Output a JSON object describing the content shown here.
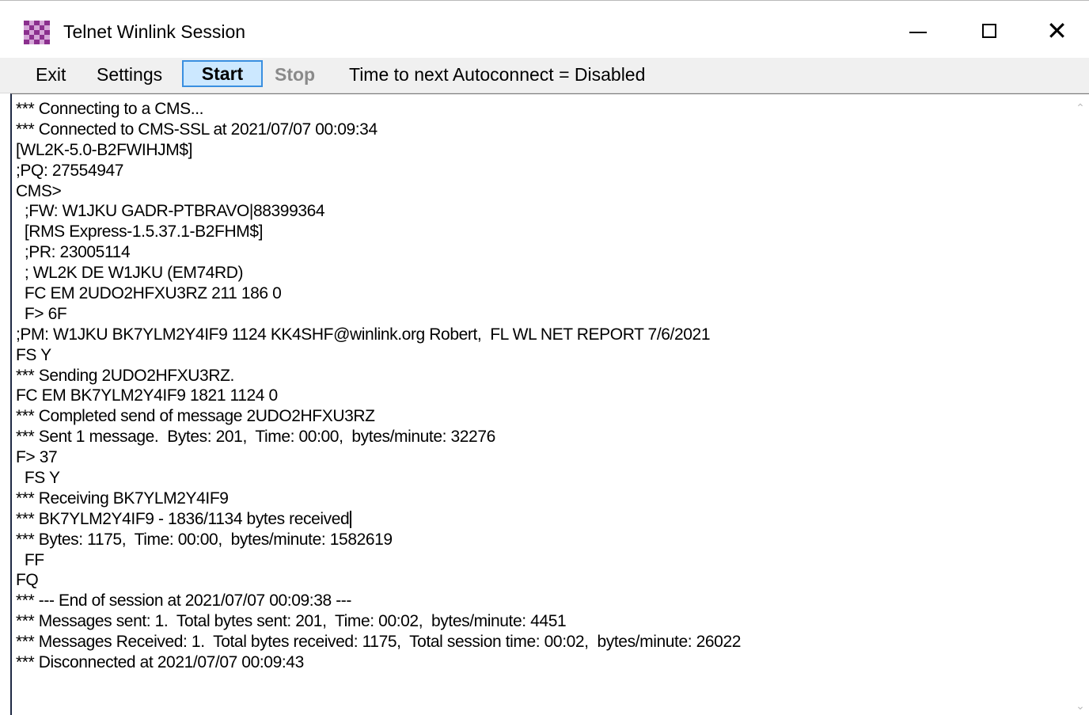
{
  "window": {
    "title": "Telnet Winlink Session",
    "icon": "winlink-checker-icon",
    "controls": {
      "minimize": "minimize-icon",
      "maximize": "maximize-icon",
      "close": "close-icon",
      "close_glyph": "✕"
    }
  },
  "menu": {
    "exit": "Exit",
    "settings": "Settings",
    "start": "Start",
    "stop": "Stop",
    "autoconnect": "Time to next Autoconnect = Disabled"
  },
  "log": {
    "lines": [
      "*** Connecting to a CMS...",
      "*** Connected to CMS-SSL at 2021/07/07 00:09:34",
      "[WL2K-5.0-B2FWIHJM$]",
      ";PQ: 27554947",
      "CMS>",
      "  ;FW: W1JKU GADR-PTBRAVO|88399364",
      "  [RMS Express-1.5.37.1-B2FHM$]",
      "  ;PR: 23005114",
      "  ; WL2K DE W1JKU (EM74RD)",
      "  FC EM 2UDO2HFXU3RZ 211 186 0",
      "  F> 6F",
      ";PM: W1JKU BK7YLM2Y4IF9 1124 KK4SHF@winlink.org Robert,  FL WL NET REPORT 7/6/2021",
      "FS Y",
      "*** Sending 2UDO2HFXU3RZ.",
      "FC EM BK7YLM2Y4IF9 1821 1124 0",
      "*** Completed send of message 2UDO2HFXU3RZ",
      "*** Sent 1 message.  Bytes: 201,  Time: 00:00,  bytes/minute: 32276",
      "F> 37",
      "  FS Y",
      "*** Receiving BK7YLM2Y4IF9",
      "*** BK7YLM2Y4IF9 - 1836/1134 bytes received",
      "*** Bytes: 1175,  Time: 00:00,  bytes/minute: 1582619",
      "  FF",
      "FQ",
      "*** --- End of session at 2021/07/07 00:09:38 ---",
      "*** Messages sent: 1.  Total bytes sent: 201,  Time: 00:02,  bytes/minute: 4451",
      "*** Messages Received: 1.  Total bytes received: 1175,  Total session time: 00:02,  bytes/minute: 26022",
      "*** Disconnected at 2021/07/07 00:09:43"
    ],
    "caret_line_index": 20
  },
  "scrollbar": {
    "up_icon": "scroll-up-arrow-icon",
    "down_icon": "scroll-down-arrow-icon",
    "up_glyph": "⌃",
    "down_glyph": "⌄"
  }
}
